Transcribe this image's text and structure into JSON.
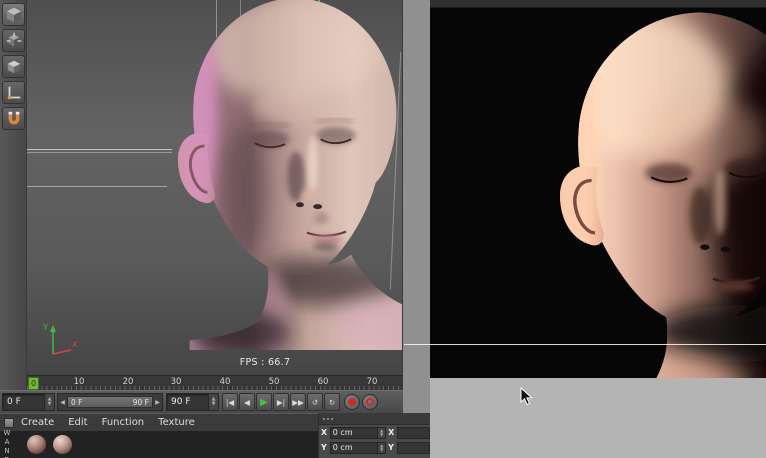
{
  "viewport": {
    "fps_label": "FPS : 66.7",
    "axis_y": "Y",
    "axis_x": "X"
  },
  "timeline": {
    "marker": "0",
    "ticks": [
      "10",
      "20",
      "30",
      "40",
      "50",
      "60",
      "70"
    ]
  },
  "transport": {
    "current_frame": "0 F",
    "range_start": "0 F",
    "range_end": "90 F",
    "end_frame": "90 F",
    "buttons": [
      {
        "name": "goto-start-button",
        "glyph": "|◀"
      },
      {
        "name": "prev-frame-button",
        "glyph": "◀"
      },
      {
        "name": "play-button",
        "glyph": "▶"
      },
      {
        "name": "next-frame-button",
        "glyph": "▶|"
      },
      {
        "name": "goto-end-button",
        "glyph": "▶▶"
      },
      {
        "name": "play-loop-backward-button",
        "glyph": "↺"
      },
      {
        "name": "play-loop-button",
        "glyph": "↻"
      }
    ]
  },
  "menu": {
    "items": [
      "Create",
      "Edit",
      "Function",
      "Texture"
    ]
  },
  "coordinates": {
    "rows": [
      {
        "axis": "X",
        "value": "0 cm",
        "axis2": "X"
      },
      {
        "axis": "Y",
        "value": "0 cm",
        "axis2": "Y"
      }
    ]
  },
  "icons": {
    "step_up": "▲",
    "step_down": "▼",
    "arrow_left": "◀",
    "arrow_right": "▶"
  },
  "watermark": "WAND",
  "colors": {
    "accent_green": "#49c24d",
    "record_red": "#cf2b24",
    "marker_green": "#6fba3c"
  }
}
